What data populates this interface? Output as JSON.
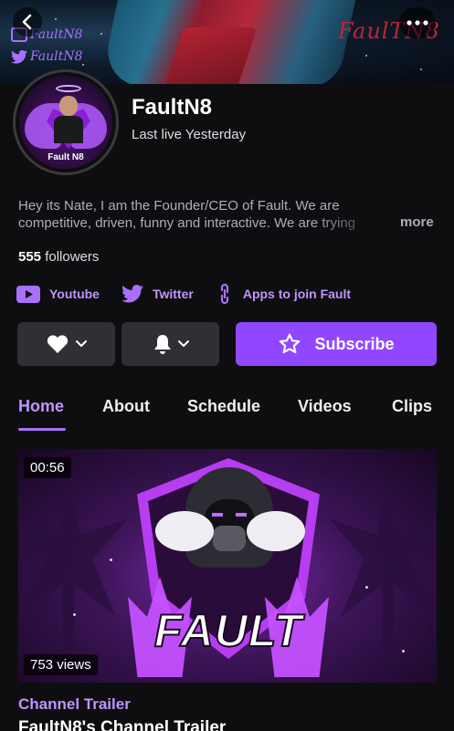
{
  "banner": {
    "brand_twitch": "FaultN8",
    "brand_twitter": "FaultN8",
    "brand_logo_text": "FaulTN8"
  },
  "channel": {
    "avatar_caption": "Fault N8",
    "name": "FaultN8",
    "last_live": "Last live Yesterday",
    "bio": "Hey its Nate, I am the Founder/CEO of Fault. We are competitive, driven, funny and interactive. We are trying",
    "bio_more": "more",
    "followers_count": "555",
    "followers_label": "followers"
  },
  "social_links": [
    {
      "label": "Youtube",
      "icon": "youtube-icon"
    },
    {
      "label": "Twitter",
      "icon": "twitter-icon"
    },
    {
      "label": "Apps to join Fault",
      "icon": "link-icon"
    }
  ],
  "actions": {
    "subscribe_label": "Subscribe"
  },
  "tabs": [
    {
      "label": "Home",
      "active": true
    },
    {
      "label": "About",
      "active": false
    },
    {
      "label": "Schedule",
      "active": false
    },
    {
      "label": "Videos",
      "active": false
    },
    {
      "label": "Clips",
      "active": false
    }
  ],
  "video": {
    "duration": "00:56",
    "views": "753 views",
    "thumbnail_text": "FAULT",
    "section_label": "Channel Trailer",
    "title": "FaultN8's Channel Trailer"
  },
  "colors": {
    "accent": "#9147ff",
    "accent_text": "#bf94ff",
    "background": "#0e0e10",
    "button_gray": "#2f2f35"
  }
}
